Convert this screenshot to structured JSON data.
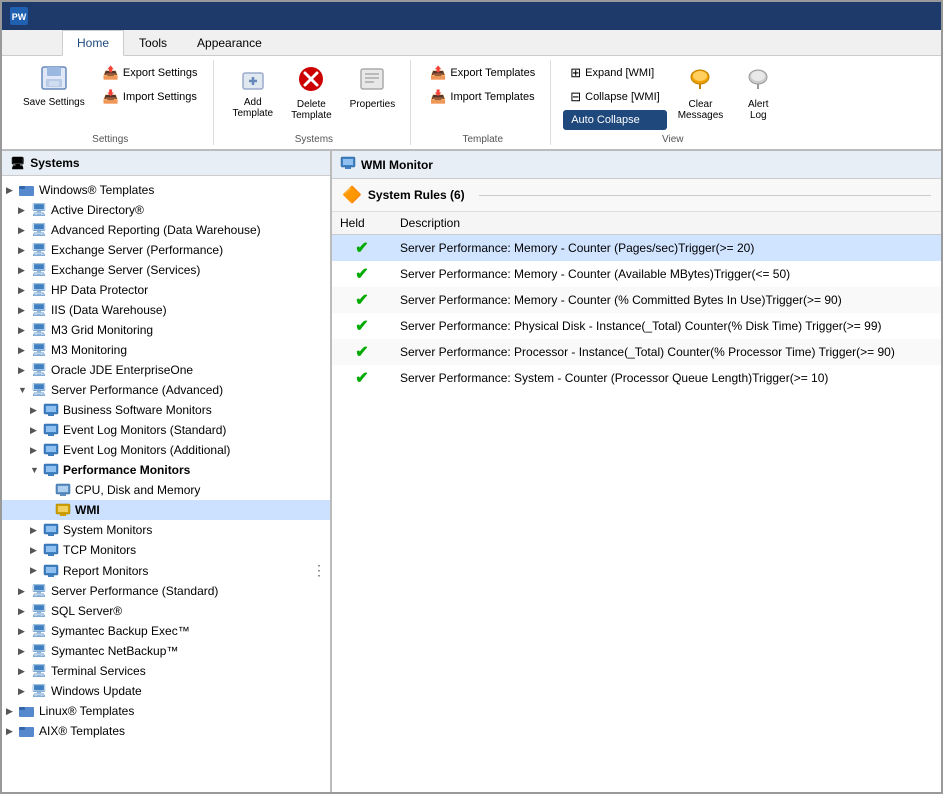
{
  "titlebar": {
    "icon": "PW"
  },
  "tabs": [
    {
      "label": "Home",
      "active": true
    },
    {
      "label": "Tools",
      "active": false
    },
    {
      "label": "Appearance",
      "active": false
    }
  ],
  "ribbon": {
    "groups": [
      {
        "label": "Settings",
        "buttons": [
          {
            "type": "large",
            "icon": "💾",
            "label": "Save\nSettings",
            "name": "save-settings-button"
          },
          {
            "type": "small-col",
            "items": [
              {
                "icon": "📤",
                "label": "Export Settings",
                "name": "export-settings-button"
              },
              {
                "icon": "📥",
                "label": "Import Settings",
                "name": "import-settings-button"
              }
            ]
          }
        ]
      },
      {
        "label": "Systems",
        "buttons": [
          {
            "type": "large",
            "icon": "➕",
            "label": "Add\nTemplate",
            "name": "add-template-button"
          },
          {
            "type": "large",
            "icon": "❌",
            "label": "Delete\nTemplate",
            "name": "delete-template-button",
            "delete": true
          },
          {
            "type": "large",
            "icon": "⚙",
            "label": "Properties",
            "name": "properties-button"
          }
        ]
      },
      {
        "label": "Template",
        "buttons": [
          {
            "type": "small-col",
            "items": [
              {
                "icon": "📤",
                "label": "Export Templates",
                "name": "export-templates-button"
              },
              {
                "icon": "📥",
                "label": "Import Templates",
                "name": "import-templates-button"
              }
            ]
          }
        ]
      },
      {
        "label": "View",
        "buttons": [
          {
            "type": "small-col",
            "items": [
              {
                "icon": "⊞",
                "label": "Expand [WMI]",
                "name": "expand-wmi-button"
              },
              {
                "icon": "⊟",
                "label": "Collapse [WMI]",
                "name": "collapse-wmi-button"
              },
              {
                "label": "Auto Collapse",
                "name": "auto-collapse-button",
                "special": true
              }
            ]
          },
          {
            "type": "large",
            "icon": "🧹",
            "label": "Clear\nMessages",
            "name": "clear-messages-button"
          },
          {
            "type": "large",
            "icon": "📋",
            "label": "Alert\nLog",
            "name": "alert-log-button"
          }
        ]
      }
    ]
  },
  "left_panel": {
    "title": "Systems",
    "tree": [
      {
        "indent": 0,
        "arrow": "▶",
        "icon": "folder",
        "label": "Windows® Templates",
        "blue": false,
        "level": "root"
      },
      {
        "indent": 1,
        "arrow": "▶",
        "icon": "monitor",
        "label": "Active Directory®",
        "blue": true
      },
      {
        "indent": 1,
        "arrow": "▶",
        "icon": "monitor",
        "label": "Advanced Reporting (Data Warehouse)",
        "blue": true
      },
      {
        "indent": 1,
        "arrow": "▶",
        "icon": "monitor",
        "label": "Exchange Server (Performance)",
        "blue": true
      },
      {
        "indent": 1,
        "arrow": "▶",
        "icon": "monitor",
        "label": "Exchange Server (Services)",
        "blue": true
      },
      {
        "indent": 1,
        "arrow": "▶",
        "icon": "monitor",
        "label": "HP Data Protector",
        "blue": true
      },
      {
        "indent": 1,
        "arrow": "▶",
        "icon": "monitor",
        "label": "IIS (Data Warehouse)",
        "blue": true
      },
      {
        "indent": 1,
        "arrow": "▶",
        "icon": "monitor",
        "label": "M3 Grid Monitoring",
        "blue": true
      },
      {
        "indent": 1,
        "arrow": "▶",
        "icon": "monitor",
        "label": "M3 Monitoring",
        "blue": true
      },
      {
        "indent": 1,
        "arrow": "▶",
        "icon": "monitor",
        "label": "Oracle JDE EnterpriseOne",
        "blue": true
      },
      {
        "indent": 1,
        "arrow": "▼",
        "icon": "monitor",
        "label": "Server Performance (Advanced)",
        "blue": true
      },
      {
        "indent": 2,
        "arrow": "▶",
        "icon": "screen",
        "label": "Business Software Monitors",
        "blue": false
      },
      {
        "indent": 2,
        "arrow": "▶",
        "icon": "screen",
        "label": "Event Log Monitors (Standard)",
        "blue": false
      },
      {
        "indent": 2,
        "arrow": "▶",
        "icon": "screen",
        "label": "Event Log Monitors (Additional)",
        "blue": false
      },
      {
        "indent": 2,
        "arrow": "▼",
        "icon": "screen",
        "label": "Performance Monitors",
        "blue": false,
        "selected": false,
        "bold": true
      },
      {
        "indent": 3,
        "arrow": "",
        "icon": "screen2",
        "label": "CPU, Disk and Memory",
        "blue": false
      },
      {
        "indent": 3,
        "arrow": "",
        "icon": "wmi",
        "label": "WMI",
        "blue": false,
        "selected": true
      },
      {
        "indent": 2,
        "arrow": "▶",
        "icon": "screen",
        "label": "System Monitors",
        "blue": false
      },
      {
        "indent": 2,
        "arrow": "▶",
        "icon": "screen",
        "label": "TCP Monitors",
        "blue": false
      },
      {
        "indent": 2,
        "arrow": "▶",
        "icon": "screen",
        "label": "Report Monitors",
        "blue": false
      },
      {
        "indent": 1,
        "arrow": "▶",
        "icon": "monitor",
        "label": "Server Performance (Standard)",
        "blue": true
      },
      {
        "indent": 1,
        "arrow": "▶",
        "icon": "monitor",
        "label": "SQL Server®",
        "blue": true
      },
      {
        "indent": 1,
        "arrow": "▶",
        "icon": "monitor",
        "label": "Symantec Backup Exec™",
        "blue": true
      },
      {
        "indent": 1,
        "arrow": "▶",
        "icon": "monitor",
        "label": "Symantec NetBackup™",
        "blue": true
      },
      {
        "indent": 1,
        "arrow": "▶",
        "icon": "monitor",
        "label": "Terminal Services",
        "blue": true
      },
      {
        "indent": 1,
        "arrow": "▶",
        "icon": "monitor",
        "label": "Windows Update",
        "blue": true
      },
      {
        "indent": 0,
        "arrow": "▶",
        "icon": "folder",
        "label": "Linux® Templates",
        "blue": false
      },
      {
        "indent": 0,
        "arrow": "▶",
        "icon": "folder",
        "label": "AIX® Templates",
        "blue": false
      }
    ]
  },
  "right_panel": {
    "title": "WMI Monitor",
    "system_rules_label": "System Rules (6)",
    "table_headers": [
      "Held",
      "Description"
    ],
    "rows": [
      {
        "held": "✔",
        "description": "Server Performance: Memory - Counter (Pages/sec)Trigger(>= 20)",
        "highlight": true
      },
      {
        "held": "✔",
        "description": "Server Performance: Memory - Counter (Available MBytes)Trigger(<= 50)",
        "highlight": false
      },
      {
        "held": "✔",
        "description": "Server Performance: Memory - Counter (% Committed Bytes In Use)Trigger(>= 90)",
        "highlight": false
      },
      {
        "held": "✔",
        "description": "Server Performance: Physical Disk - Instance(_Total) Counter(% Disk Time) Trigger(>= 99)",
        "highlight": false
      },
      {
        "held": "✔",
        "description": "Server Performance: Processor - Instance(_Total) Counter(% Processor Time) Trigger(>= 90)",
        "highlight": false
      },
      {
        "held": "✔",
        "description": "Server Performance: System - Counter (Processor Queue Length)Trigger(>= 10)",
        "highlight": false
      }
    ]
  }
}
